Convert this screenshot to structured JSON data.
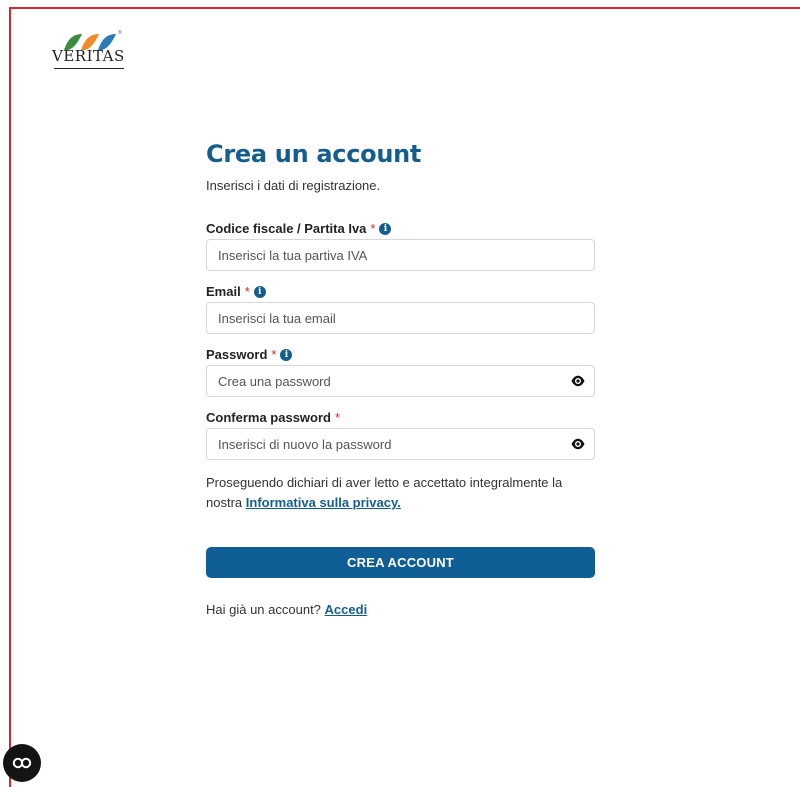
{
  "logo": {
    "text": "VERITAS"
  },
  "form": {
    "title": "Crea un account",
    "subtitle": "Inserisci i dati di registrazione.",
    "required_mark": "*",
    "fields": {
      "tax_code": {
        "label": "Codice fiscale / Partita Iva",
        "placeholder": "Inserisci la tua partiva IVA",
        "value": ""
      },
      "email": {
        "label": "Email",
        "placeholder": "Inserisci la tua email",
        "value": ""
      },
      "password": {
        "label": "Password",
        "placeholder": "Crea una password",
        "value": ""
      },
      "confirm_password": {
        "label": "Conferma password",
        "placeholder": "Inserisci di nuovo la password",
        "value": ""
      }
    },
    "privacy_text": "Proseguendo dichiari di aver letto e accettato integralmente la nostra",
    "privacy_link": "Informativa sulla privacy.",
    "submit_label": "CREA ACCOUNT",
    "login_prompt": "Hai già un account?",
    "login_link": "Accedi"
  },
  "colors": {
    "primary": "#145e8f",
    "button": "#0f5e95",
    "required": "#d62828",
    "frame": "#d9262a"
  },
  "icons": {
    "info": "info-circle-icon",
    "eye": "eye-icon",
    "accessibility": "accessibility-icon"
  }
}
